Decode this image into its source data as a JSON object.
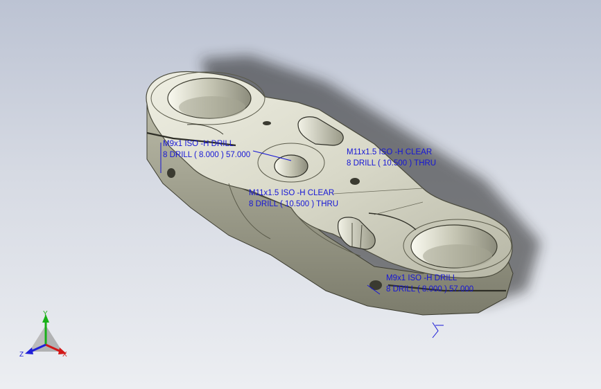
{
  "viewport": {
    "background_top": "#bcc3d3",
    "background_bottom": "#eceef2"
  },
  "annotations": [
    {
      "line1": "M9x1 ISO -H DRILL",
      "line2": "8 DRILL ( 8.000 )   57.000"
    },
    {
      "line1": "M11x1.5 ISO -H CLEAR",
      "line2": "8 DRILL ( 10.500 )  THRU"
    },
    {
      "line1": "M11x1.5 ISO -H CLEAR",
      "line2": "8 DRILL ( 10.500 )  THRU"
    },
    {
      "line1": "M9x1 ISO -H DRILL",
      "line2": "8 DRILL ( 8.000 )   57.000"
    }
  ],
  "triad": {
    "x": "X",
    "y": "Y",
    "z": "Z"
  },
  "colors": {
    "annotation": "#1515d6",
    "part_surface": "#d8d8c8",
    "x_axis": "#d21818",
    "y_axis": "#18b018",
    "z_axis": "#2020d8"
  }
}
